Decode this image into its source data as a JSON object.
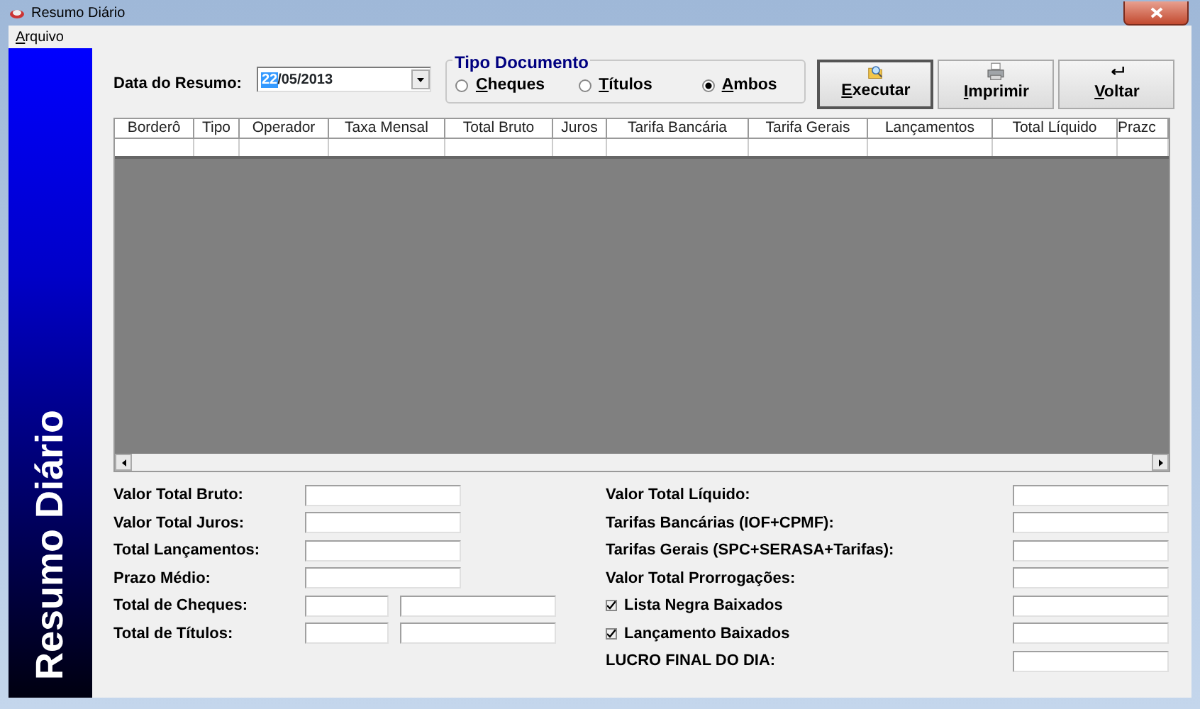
{
  "window": {
    "title": "Resumo Diário"
  },
  "menu": [
    {
      "label": "Arquivo"
    }
  ],
  "sidebar": {
    "title": "Resumo Diário"
  },
  "date": {
    "label": "Data do Resumo:",
    "value": [
      {
        "text": "22",
        "selected": true
      },
      {
        "text": "/05/2013",
        "selected": false
      }
    ]
  },
  "tipo_documento": {
    "legend": "Tipo Documento",
    "options": [
      {
        "label": "Cheques",
        "selected": false
      },
      {
        "label": "Títulos",
        "selected": false
      },
      {
        "label": "Ambos",
        "selected": true
      }
    ]
  },
  "buttons": [
    {
      "label": "Executar",
      "kind": "search",
      "default": true
    },
    {
      "label": "Imprimir",
      "kind": "print",
      "default": false
    },
    {
      "label": "Voltar",
      "kind": "back",
      "default": false
    }
  ],
  "table": {
    "columns": [
      "Borderô",
      "Tipo",
      "Operador",
      "Taxa Mensal",
      "Total Bruto",
      "Juros",
      "Tarifa Bancária",
      "Tarifa Gerais",
      "Lançamentos",
      "Total Líquido",
      "Prazc"
    ]
  },
  "summary_left": [
    {
      "label": "Valor Total Bruto:",
      "kind": "single"
    },
    {
      "label": "Valor Total Juros:",
      "kind": "single"
    },
    {
      "label": "Total Lançamentos:",
      "kind": "single"
    },
    {
      "label": "Prazo Médio:",
      "kind": "single"
    },
    {
      "label": "Total de Cheques:",
      "kind": "double"
    },
    {
      "label": "Total de Títulos:",
      "kind": "double"
    }
  ],
  "summary_right": [
    {
      "label": "Valor Total Líquido:",
      "kind": "label"
    },
    {
      "label": "Tarifas Bancárias (IOF+CPMF):",
      "kind": "label"
    },
    {
      "label": "Tarifas Gerais (SPC+SERASA+Tarifas):",
      "kind": "label"
    },
    {
      "label": "Valor Total Prorrogações:",
      "kind": "label"
    },
    {
      "label": "Lista Negra Baixados",
      "kind": "checkbox",
      "checked": true
    },
    {
      "label": "Lançamento Baixados",
      "kind": "checkbox",
      "checked": true
    },
    {
      "label": "LUCRO FINAL DO DIA:",
      "kind": "label"
    }
  ]
}
